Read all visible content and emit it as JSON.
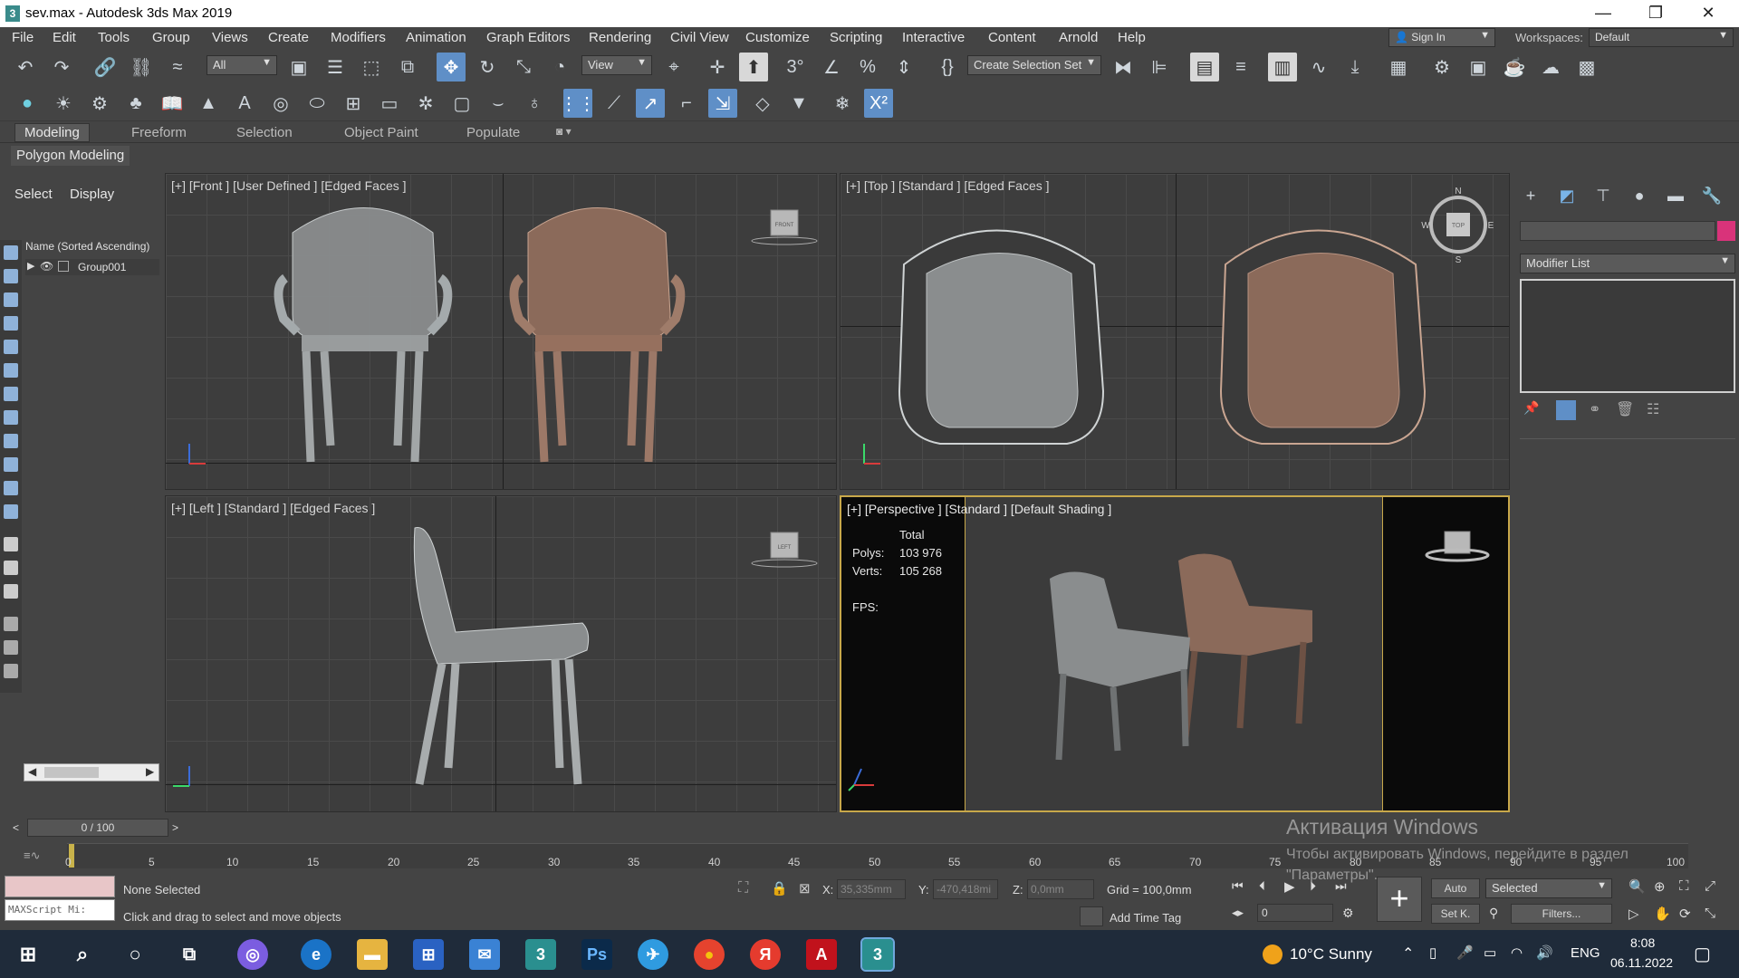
{
  "window": {
    "title": "sev.max - Autodesk 3ds Max 2019",
    "app_icon": "3",
    "minimize_glyph": "—",
    "restore_glyph": "❐",
    "close_glyph": "✕"
  },
  "menu": [
    "File",
    "Edit",
    "Tools",
    "Group",
    "Views",
    "Create",
    "Modifiers",
    "Animation",
    "Graph Editors",
    "Rendering",
    "Civil View",
    "Customize",
    "Scripting",
    "Interactive",
    "Content",
    "Arnold",
    "Help"
  ],
  "account": {
    "sign_in": "Sign In",
    "workspaces_label": "Workspaces:",
    "workspace_value": "Default"
  },
  "toolbar": {
    "selection_filter": "All",
    "ref_coord": "View",
    "create_selection_set": "Create Selection Set"
  },
  "ribbon": {
    "tabs": [
      "Modeling",
      "Freeform",
      "Selection",
      "Object Paint",
      "Populate"
    ],
    "active_tab": "Modeling",
    "sub_tab": "Polygon Modeling"
  },
  "scene_explorer": {
    "tabs": [
      "Select",
      "Display"
    ],
    "column": "Name (Sorted Ascending)",
    "items": [
      "Group001"
    ]
  },
  "viewports": {
    "front": "[+] [Front ] [User Defined ] [Edged Faces ]",
    "top": "[+] [Top ] [Standard ] [Edged Faces ]",
    "left": "[+] [Left ] [Standard ] [Edged Faces ]",
    "perspective": "[+] [Perspective ] [Standard ] [Default Shading ]",
    "front_cube": "FRONT",
    "left_cube": "LEFT",
    "top_cube": "TOP",
    "compass": {
      "n": "N",
      "s": "S",
      "e": "E",
      "w": "W"
    },
    "stats": {
      "total_label": "Total",
      "polys_label": "Polys:",
      "polys_value": "103 976",
      "verts_label": "Verts:",
      "verts_value": "105 268",
      "fps_label": "FPS:"
    }
  },
  "command_panel": {
    "modifier_list": "Modifier List"
  },
  "timeline": {
    "frame": "0 / 100",
    "ticks": [
      "0",
      "5",
      "10",
      "15",
      "20",
      "25",
      "30",
      "35",
      "40",
      "45",
      "50",
      "55",
      "60",
      "65",
      "70",
      "75",
      "80",
      "85",
      "90",
      "95",
      "100"
    ]
  },
  "status": {
    "maxscript": "MAXScript Mi:",
    "selection": "None Selected",
    "prompt": "Click and drag to select and move objects",
    "x_label": "X:",
    "x_value": "35,335mm",
    "y_label": "Y:",
    "y_value": "-470,418mi",
    "z_label": "Z:",
    "z_value": "0,0mm",
    "grid": "Grid = 100,0mm",
    "add_time_tag": "Add Time Tag",
    "auto": "Auto",
    "selected": "Selected",
    "set_key": "Set K.",
    "filters": "Filters...",
    "frame_field": "0"
  },
  "watermark": {
    "line1": "Активация Windows",
    "line2": "Чтобы активировать Windows, перейдите в раздел",
    "line3": "\"Параметры\"."
  },
  "taskbar": {
    "weather": "10°C  Sunny",
    "lang": "ENG",
    "time": "8:08",
    "date": "06.11.2022",
    "apps": [
      {
        "name": "3",
        "color": "#2a8f8f"
      },
      {
        "name": "Ps",
        "color": "#0b2a4a"
      },
      {
        "name": "✈",
        "color": "#2f9be0"
      },
      {
        "name": "●",
        "color": "#e5432e"
      },
      {
        "name": "Я",
        "color": "#e53b2e"
      },
      {
        "name": "A",
        "color": "#c1121c"
      },
      {
        "name": "3",
        "color": "#2a8f8f"
      }
    ]
  },
  "colors": {
    "accent": "#5f8fc7",
    "viewport_bg": "#3d3d3d",
    "perspective_bg": "#0a0a0a",
    "active_border": "#c8a84a",
    "chair_grey": "#8a8d8e",
    "chair_brown": "#8b6a5a",
    "swatch": "#d9337a"
  }
}
